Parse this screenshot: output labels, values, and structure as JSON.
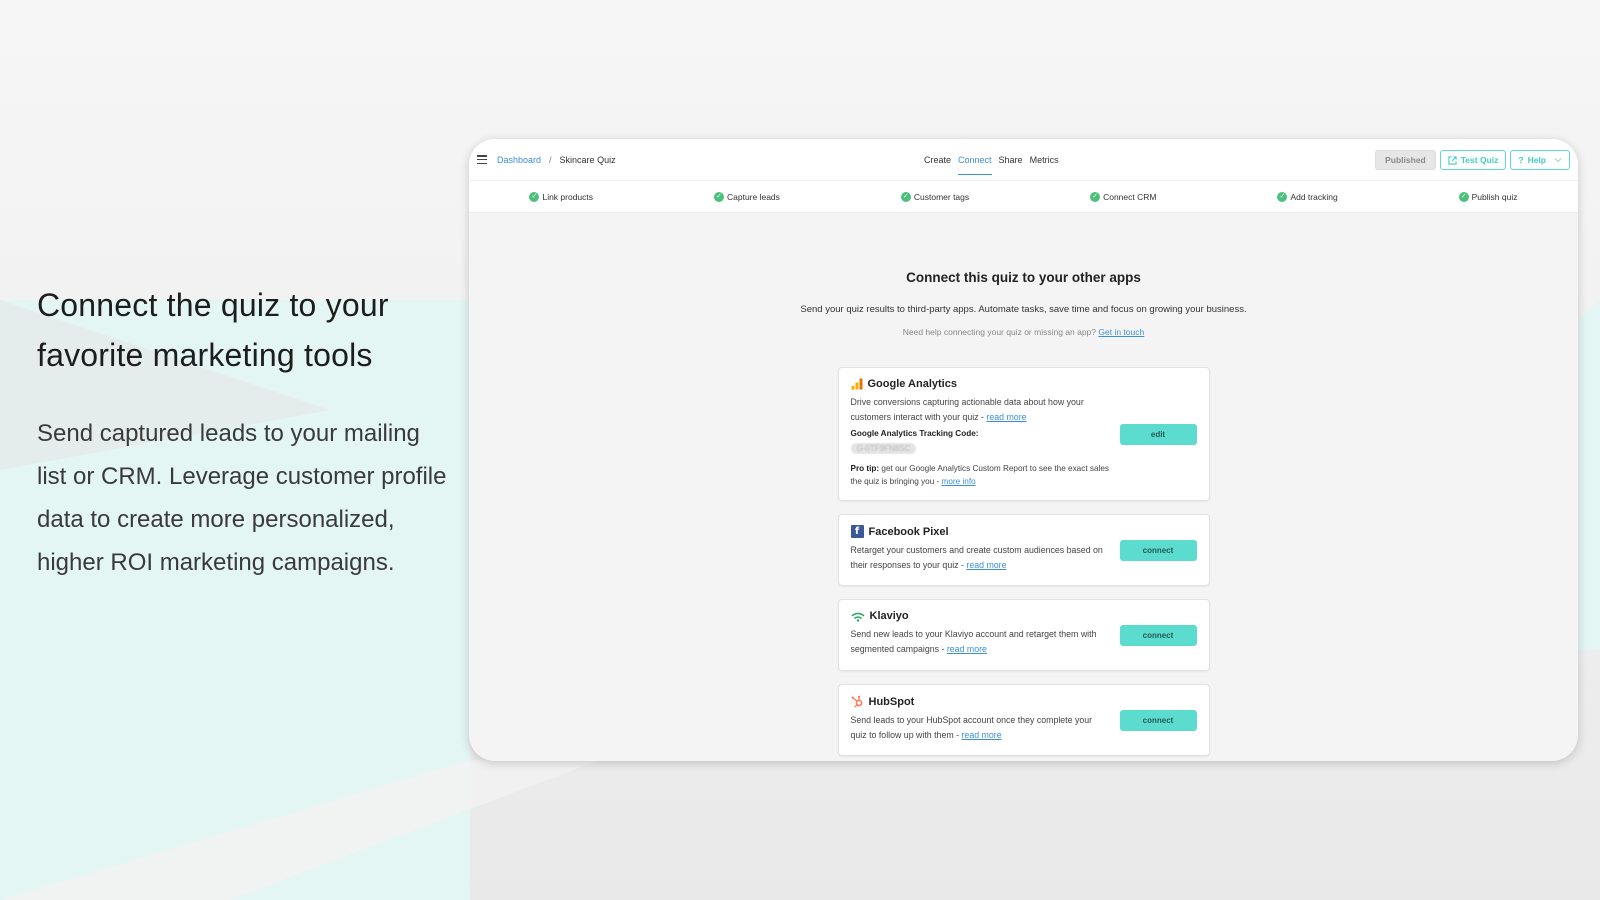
{
  "hero": {
    "title": "Connect the quiz to your favorite marketing tools",
    "subtitle": "Send captured leads to your mailing list or CRM. Leverage customer profile data to create more personalized, higher ROI marketing campaigns."
  },
  "colors": {
    "accent_blue": "#3b8fd9",
    "teal_button": "#5cdbcf",
    "check_green": "#4cc07c"
  },
  "topbar": {
    "breadcrumb_root": "Dashboard",
    "breadcrumb_separator": "/",
    "breadcrumb_current": "Skincare Quiz",
    "tabs": [
      {
        "label": "Create",
        "active": false
      },
      {
        "label": "Connect",
        "active": true
      },
      {
        "label": "Share",
        "active": false
      },
      {
        "label": "Metrics",
        "active": false
      }
    ],
    "published_label": "Published",
    "test_quiz_label": "Test Quiz",
    "help_label": "Help"
  },
  "steps": [
    {
      "label": "Link products",
      "done": true
    },
    {
      "label": "Capture leads",
      "done": true
    },
    {
      "label": "Customer tags",
      "done": true
    },
    {
      "label": "Connect CRM",
      "done": true
    },
    {
      "label": "Add tracking",
      "done": true
    },
    {
      "label": "Publish quiz",
      "done": true
    }
  ],
  "main": {
    "title": "Connect this quiz to your other apps",
    "subtitle": "Send your quiz results to third-party apps. Automate tasks, save time and focus on growing your business.",
    "help_text": "Need help connecting your quiz or missing an app?",
    "help_link": "Get in touch"
  },
  "integrations": {
    "google_analytics": {
      "name": "Google Analytics",
      "description": "Drive conversions capturing actionable data about how your customers interact with your quiz - ",
      "read_more": "read more",
      "tracking_label": "Google Analytics Tracking Code:",
      "tracking_code": "G-0TF9FN8SC",
      "tip_label": "Pro tip:",
      "tip_text": " get our Google Analytics Custom Report to see the exact sales the quiz is bringing you - ",
      "tip_link": "more info",
      "button": "edit"
    },
    "facebook_pixel": {
      "name": "Facebook Pixel",
      "description": "Retarget your customers and create custom audiences based on their responses to your quiz - ",
      "read_more": "read more",
      "button": "connect"
    },
    "klaviyo": {
      "name": "Klaviyo",
      "description": "Send new leads to your Klaviyo account and retarget them with segmented campaigns - ",
      "read_more": "read more",
      "button": "connect"
    },
    "hubspot": {
      "name": "HubSpot",
      "description": "Send leads to your HubSpot account once they complete your quiz to follow up with them - ",
      "read_more": "read more",
      "button": "connect"
    }
  }
}
